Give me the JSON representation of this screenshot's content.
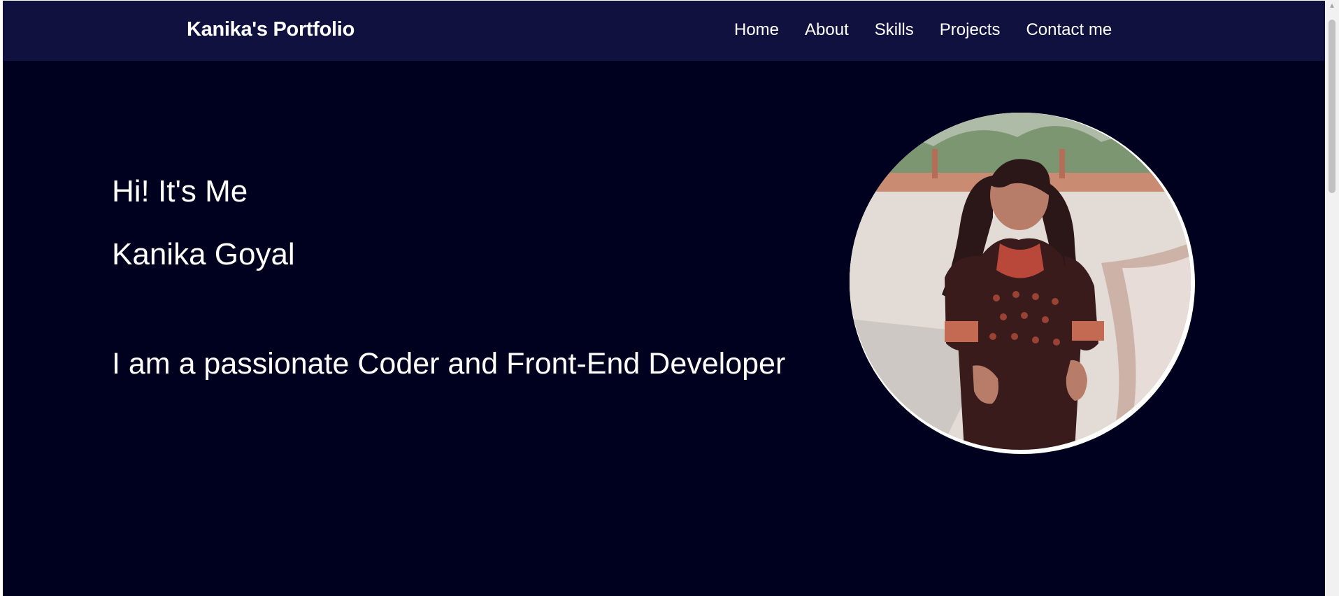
{
  "navbar": {
    "brand": "Kanika's Portfolio",
    "links": [
      "Home",
      "About",
      "Skills",
      "Projects",
      "Contact me"
    ]
  },
  "hero": {
    "greeting": "Hi! It's Me",
    "name": "Kanika Goyal",
    "tagline": "I am a passionate Coder and Front-End Developer"
  },
  "colors": {
    "page_background": "#00001f",
    "navbar_background": "#10113f",
    "text": "#ffffff"
  },
  "icons": {
    "scroll_up": "up-arrow-icon"
  }
}
